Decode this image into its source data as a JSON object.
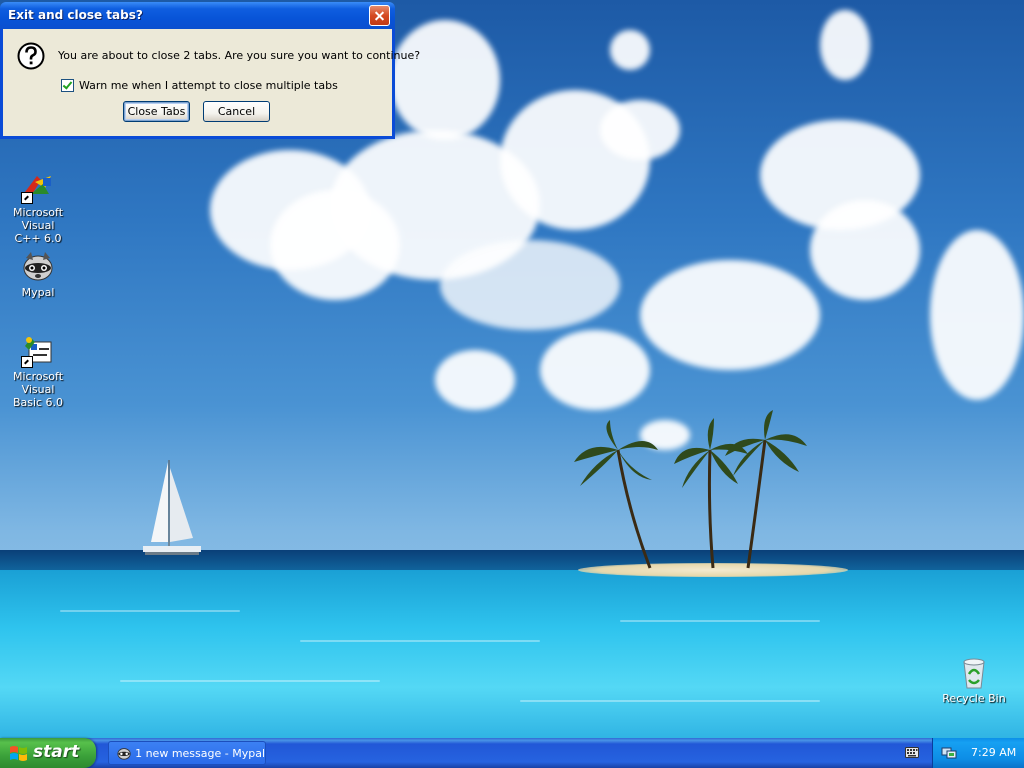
{
  "dialog": {
    "title": "Exit and close tabs?",
    "message": "You are about to close 2 tabs. Are you sure you want to continue?",
    "checkbox_label": "Warn me when I attempt to close multiple tabs",
    "checkbox_checked": true,
    "close_tabs_label": "Close Tabs",
    "cancel_label": "Cancel",
    "icon": "question-icon"
  },
  "desktop": {
    "icons": [
      {
        "label_line1": "Microsoft Visual",
        "label_line2": "C++ 6.0",
        "icon": "visual-cpp-icon"
      },
      {
        "label": "Mypal",
        "icon": "mypal-icon"
      },
      {
        "label_line1": "Microsoft Visual",
        "label_line2": "Basic 6.0",
        "icon": "visual-basic-icon"
      },
      {
        "label": "Recycle Bin",
        "icon": "recycle-bin-icon"
      }
    ]
  },
  "taskbar": {
    "start_label": "start",
    "task_item_label": "1 new message - Mypal",
    "clock": "7:29 AM"
  },
  "colors": {
    "title_bar": "#0854d8",
    "dialog_body": "#ece9d8",
    "taskbar": "#2663e0",
    "start_button": "#3ba13a",
    "tray": "#0d8de6"
  }
}
